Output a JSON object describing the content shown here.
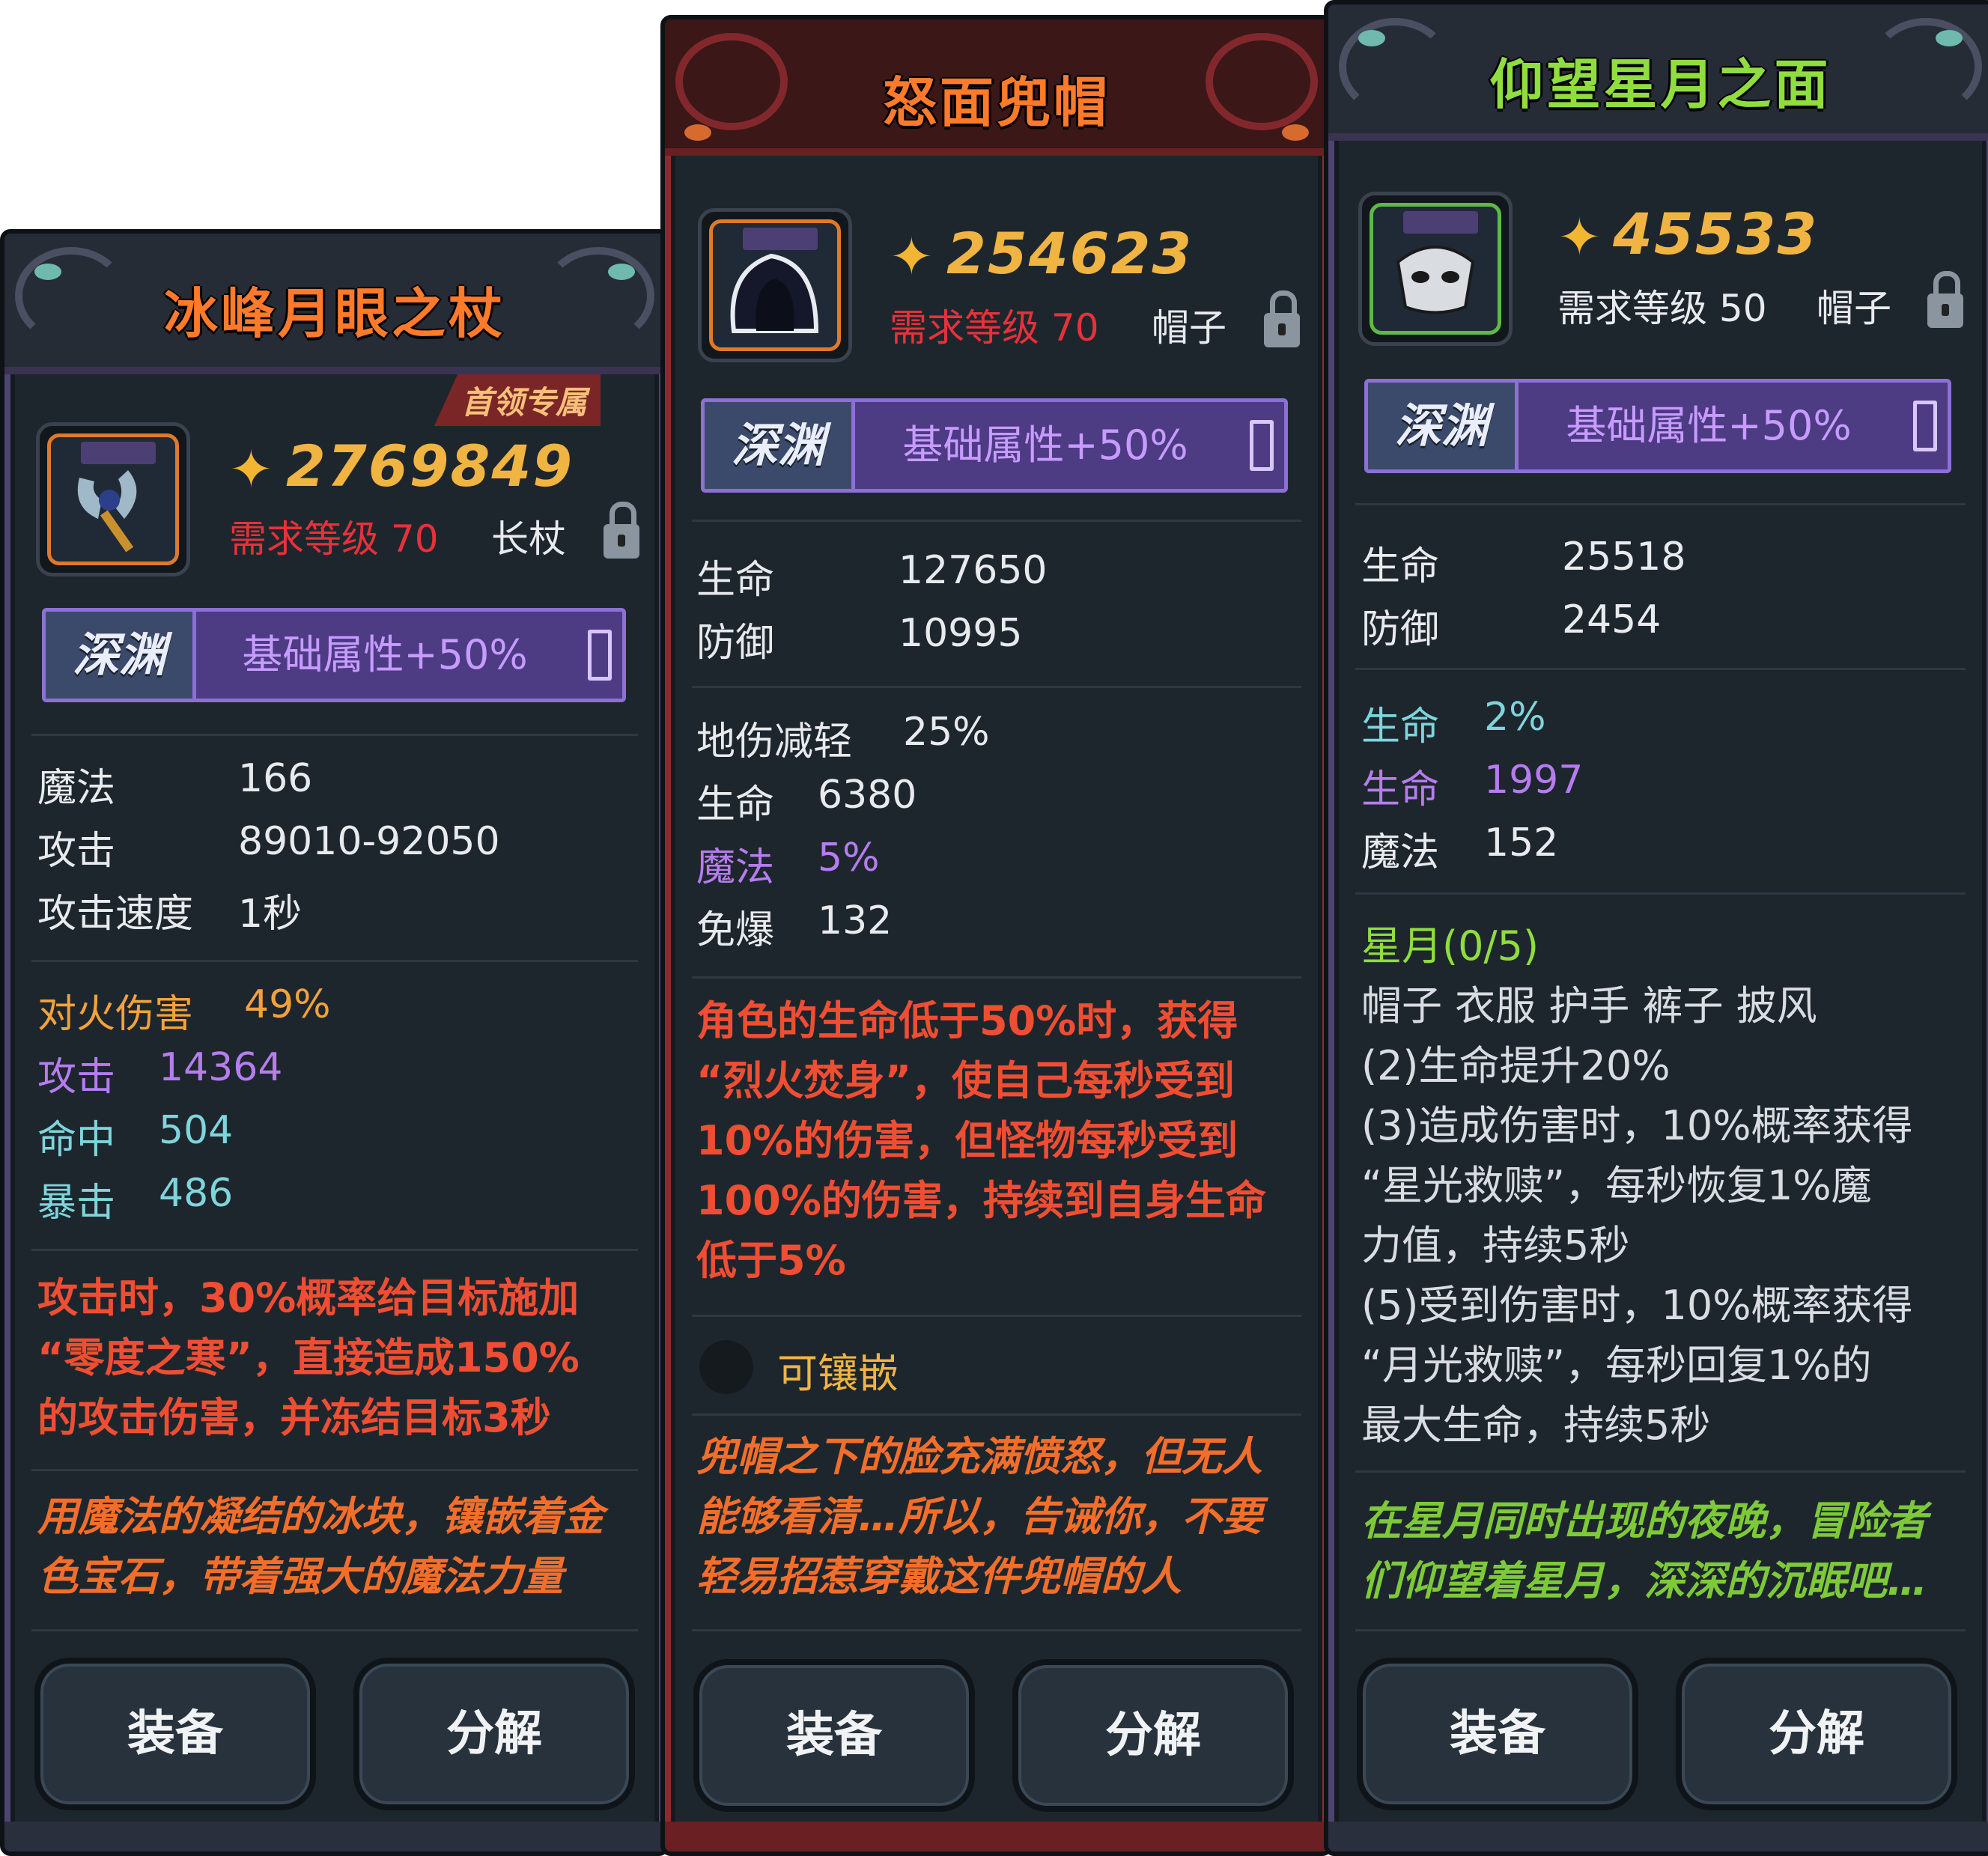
{
  "cards": [
    {
      "title": "冰峰月眼之杖",
      "badge": "首领专属",
      "score": "2769849",
      "req": "需求等级 70",
      "type": "长杖",
      "abyss": {
        "label": "深渊",
        "text": "基础属性+50%"
      },
      "base_stats": [
        {
          "k": "魔法",
          "v": "166"
        },
        {
          "k": "攻击",
          "v": "89010-92050"
        },
        {
          "k": "攻击速度",
          "v": "1秒"
        }
      ],
      "extra_stats": [
        {
          "k": "对火伤害",
          "v": "49%",
          "color": "orange"
        },
        {
          "k": "攻击",
          "v": "14364",
          "color": "purple"
        },
        {
          "k": "命中",
          "v": "504",
          "color": "cyan"
        },
        {
          "k": "暴击",
          "v": "486",
          "color": "cyan"
        }
      ],
      "effect": [
        "攻击时，30%概率给目标施加",
        " “零度之寒”，直接造成150%",
        "的攻击伤害，并冻结目标3秒"
      ],
      "flavor": [
        "用魔法的凝结的冰块，镶嵌着金",
        "色宝石，带着强大的魔法力量"
      ],
      "buttons": {
        "equip": "装备",
        "decompose": "分解"
      }
    },
    {
      "title": "怒面兜帽",
      "score": "254623",
      "req": "需求等级 70",
      "type": "帽子",
      "abyss": {
        "label": "深渊",
        "text": "基础属性+50%"
      },
      "base_stats": [
        {
          "k": "生命",
          "v": "127650"
        },
        {
          "k": "防御",
          "v": "10995"
        }
      ],
      "extra_stats": [
        {
          "k": "地伤减轻",
          "v": "25%",
          "color": "white"
        },
        {
          "k": "生命",
          "v": "6380",
          "color": "white"
        },
        {
          "k": "魔法",
          "v": "5%",
          "color": "purple"
        },
        {
          "k": "免爆",
          "v": "132",
          "color": "white"
        }
      ],
      "effect": [
        "角色的生命低于50%时，获得",
        " “烈火焚身”，使自己每秒受到",
        "10%的伤害，但怪物每秒受到",
        "100%的伤害，持续到自身生命",
        "低于5%"
      ],
      "socket": "可镶嵌",
      "flavor": [
        "兜帽之下的脸充满愤怒，但无人",
        "能够看清…所以，告诫你，不要",
        "轻易招惹穿戴这件兜帽的人"
      ],
      "buttons": {
        "equip": "装备",
        "decompose": "分解"
      }
    },
    {
      "title": "仰望星月之面",
      "score": "45533",
      "req": "需求等级 50",
      "type": "帽子",
      "abyss": {
        "label": "深渊",
        "text": "基础属性+50%"
      },
      "base_stats": [
        {
          "k": "生命",
          "v": "25518"
        },
        {
          "k": "防御",
          "v": "2454"
        }
      ],
      "extra_stats": [
        {
          "k": "生命",
          "v": "2%",
          "color": "cyan"
        },
        {
          "k": "生命",
          "v": "1997",
          "color": "purple"
        },
        {
          "k": "魔法",
          "v": "152",
          "color": "white"
        }
      ],
      "set_title": "星月(0/5)",
      "set_lines": [
        "帽子 衣服 护手 裤子 披风",
        "(2)生命提升20%",
        "(3)造成伤害时，10%概率获得",
        " “星光救赎”，每秒恢复1%魔",
        "力值，持续5秒",
        "(5)受到伤害时，10%概率获得",
        " “月光救赎”，每秒回复1%的",
        "最大生命，持续5秒"
      ],
      "flavor": [
        "在星月同时出现的夜晚，冒险者",
        "们仰望着星月，深深的沉眠吧…"
      ],
      "buttons": {
        "equip": "装备",
        "decompose": "分解"
      }
    }
  ],
  "colors": {
    "score": "#f0b443",
    "req_red": "#e8313a",
    "effect_red": "#f2533b",
    "flavor_orange": "#f26e2a",
    "flavor_green": "#7dc93a",
    "abyss_purple": "#4d3b84"
  },
  "icons": [
    "gear-icon",
    "lock-icon",
    "staff-icon",
    "hood-icon",
    "mask-icon"
  ]
}
